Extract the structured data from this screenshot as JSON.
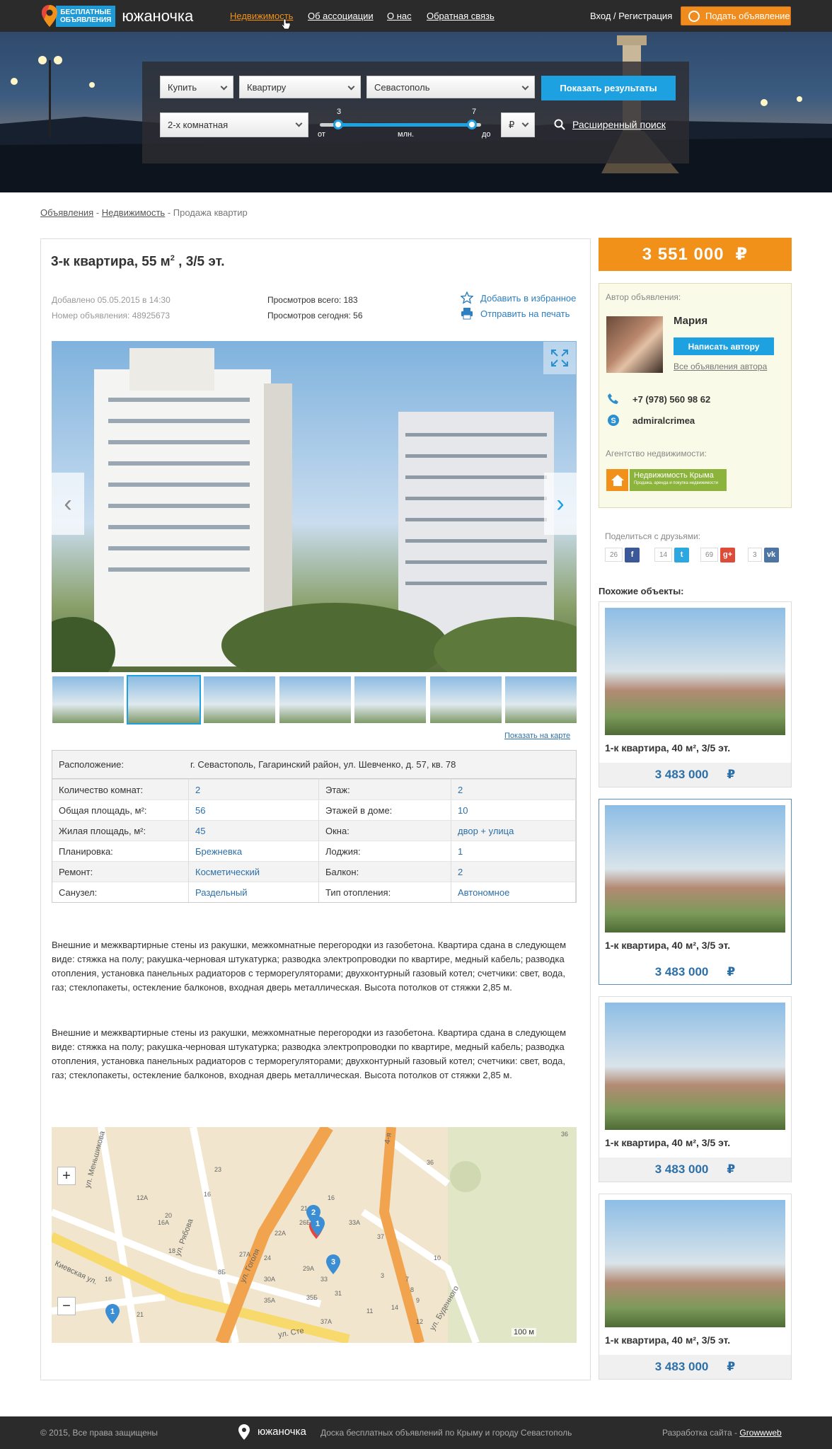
{
  "header": {
    "logo_badge_line1": "БЕСПЛАТНЫЕ",
    "logo_badge_line2": "ОБЪЯВЛЕНИЯ",
    "brand": "южаночка",
    "nav": [
      "Недвижимость",
      "Об ассоциации",
      "О нас",
      "Обратная связь"
    ],
    "login": "Вход / Регистрация",
    "post_button": "Подать объявление"
  },
  "search": {
    "deal": "Купить",
    "object": "Квартиру",
    "city": "Севастополь",
    "rooms": "2-х комнатная",
    "min_value": "3",
    "max_value": "7",
    "label_from": "от",
    "label_unit": "млн.",
    "label_to": "до",
    "currency": "₽",
    "submit": "Показать результаты",
    "advanced": "Расширенный поиск"
  },
  "breadcrumb": {
    "items": [
      "Объявления",
      "Недвижимость"
    ],
    "current": "Продажа квартир",
    "sep": " - "
  },
  "listing": {
    "title_main": "3-к квартира, 55 м",
    "title_sup": "2",
    "title_tail": " , 3/5 эт.",
    "added": "Добавлено 05.05.2015 в 14:30",
    "number": "Номер объявления: 48925673",
    "views_total": "Просмотров всего: 183",
    "views_today": "Просмотров сегодня: 56",
    "fav": "Добавить в избранное",
    "print": "Отправить на печать",
    "show_map": "Показать на карте"
  },
  "details": {
    "location_label": "Расположение:",
    "location_value": "г. Севастополь, Гагаринский район, ул. Шевченко, д. 57, кв. 78",
    "rows": [
      {
        "l1": "Количество комнат:",
        "v1": "2",
        "l2": "Этаж:",
        "v2": "2"
      },
      {
        "l1": "Общая площадь, м²:",
        "v1": "56",
        "l2": "Этажей в доме:",
        "v2": "10"
      },
      {
        "l1": "Жилая площадь, м²:",
        "v1": "45",
        "l2": "Окна:",
        "v2": "двор + улица"
      },
      {
        "l1": "Планировка:",
        "v1": "Брежневка",
        "l2": "Лоджия:",
        "v2": "1"
      },
      {
        "l1": "Ремонт:",
        "v1": "Косметический",
        "l2": "Балкон:",
        "v2": "2"
      },
      {
        "l1": "Санузел:",
        "v1": "Раздельный",
        "l2": "Тип отопления:",
        "v2": "Автономное"
      }
    ]
  },
  "description": [
    "Внешние и межквартирные стены из ракушки, межкомнатные перегородки из газобетона. Квартира сдана в следующем виде: стяжка на полу; ракушка-черновая штукатурка; разводка электропроводки по квартире, медный кабель; разводка отопления, установка панельных радиаторов с терморегуляторами; двухконтурный газовый котел; счетчики: свет, вода, газ; стеклопакеты, остекление балконов, входная дверь металлическая. Высота потолков от стяжки 2,85 м.",
    "Внешние и межквартирные стены из ракушки, межкомнатные перегородки из газобетона. Квартира сдана в следующем виде: стяжка на полу; ракушка-черновая штукатурка; разводка электропроводки по квартире, медный кабель; разводка отопления, установка панельных радиаторов с терморегуляторами; двухконтурный газовый котел; счетчики: свет, вода, газ; стеклопакеты, остекление балконов, входная дверь металлическая. Высота потолков от стяжки 2,85 м."
  ],
  "map": {
    "zoom_in": "+",
    "zoom_out": "−",
    "scale": "100 м",
    "streets": [
      "ул. Меньшикова",
      "Киевская ул.",
      "ул. Рябова",
      "ул. Гоголя",
      "ул. Буденного",
      "4-я",
      "ул. Сте"
    ],
    "labels": [
      "12А",
      "20",
      "16",
      "18",
      "8Б",
      "16А",
      "21",
      "16",
      "23",
      "22А",
      "21А",
      "26Б",
      "27А",
      "24",
      "30А",
      "29А",
      "33",
      "35Б",
      "35А",
      "37А",
      "31",
      "33А",
      "36",
      "37",
      "3",
      "7",
      "8",
      "9",
      "10",
      "11",
      "12",
      "14",
      "16",
      "36"
    ],
    "pins": [
      "1",
      "2",
      "3"
    ]
  },
  "sidebar": {
    "price": "3 551 000",
    "currency": "₽",
    "author_label": "Автор объявления:",
    "author_name": "Мария",
    "write": "Написать автору",
    "all_ads": "Все объявления автора",
    "phone": "+7 (978) 560 98 62",
    "skype": "admiralcrimea",
    "agency_label": "Агентство недвижимости:",
    "agency_name": "Недвижимость Крыма",
    "agency_sub": "Продажа, аренда и покупка недвижимости",
    "share_label": "Поделиться с друзьями:",
    "share": [
      {
        "count": "26",
        "icon": "f",
        "color": "#3b5998"
      },
      {
        "count": "14",
        "icon": "t",
        "color": "#2ca7e0"
      },
      {
        "count": "69",
        "icon": "g+",
        "color": "#dd4b39"
      },
      {
        "count": "3",
        "icon": "vk",
        "color": "#4c75a3"
      }
    ],
    "similar_label": "Похожие объекты:",
    "similar": [
      {
        "title": "1-к квартира, 40 м², 3/5 эт.",
        "price": "3 483 000",
        "currency": "₽"
      },
      {
        "title": "1-к квартира, 40 м², 3/5 эт.",
        "price": "3 483 000",
        "currency": "₽"
      },
      {
        "title": "1-к квартира, 40 м², 3/5 эт.",
        "price": "3 483 000",
        "currency": "₽"
      },
      {
        "title": "1-к квартира, 40 м², 3/5 эт.",
        "price": "3 483 000",
        "currency": "₽"
      }
    ]
  },
  "footer": {
    "copyright": "© 2015, Все права защищены",
    "brand": "южаночка",
    "tagline": "Доска бесплатных объявлений по Крыму и городу Севастополь",
    "dev_label": "Разработка сайта - ",
    "dev_link": "Growwweb"
  },
  "colors": {
    "accent": "#1ea1e0",
    "orange": "#f29119",
    "link": "#2c6fa8"
  }
}
